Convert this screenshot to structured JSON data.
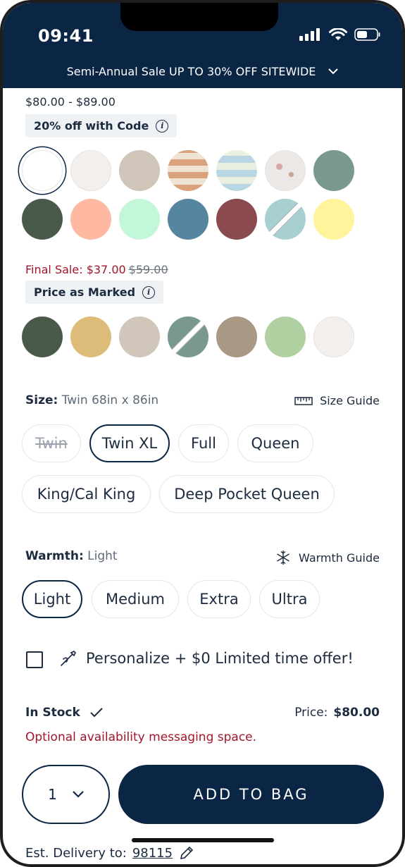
{
  "status_bar": {
    "time": "09:41"
  },
  "promo_banner": {
    "text": "Semi-Annual Sale UP TO 30% OFF SITEWIDE"
  },
  "product": {
    "price_range": "$80.00 - $89.00",
    "code_badge": "20% off with Code",
    "colors_regular": [
      {
        "name": "white",
        "color": "#ffffff"
      },
      {
        "name": "cream",
        "color": "#f3efed"
      },
      {
        "name": "stone",
        "color": "#cfc5b8"
      },
      {
        "name": "floral-stripe",
        "color": "#d9a27a"
      },
      {
        "name": "sky-floral",
        "color": "#b9d6e4"
      },
      {
        "name": "cherry-blossom",
        "color": "#e9e5e3"
      },
      {
        "name": "sage",
        "color": "#79998f"
      },
      {
        "name": "forest",
        "color": "#4a5a4a"
      },
      {
        "name": "peach",
        "color": "#ffb8a1"
      },
      {
        "name": "mint",
        "color": "#c3f7d9"
      },
      {
        "name": "denim",
        "color": "#55859f"
      },
      {
        "name": "burgundy",
        "color": "#8b4a4d"
      },
      {
        "name": "aqua-unavailable",
        "color": "#a8cfd1"
      },
      {
        "name": "lemon",
        "color": "#fff39b"
      }
    ],
    "final_sale": {
      "label": "Final Sale: $37.00",
      "was": "$59.00"
    },
    "price_marked_badge": "Price as Marked",
    "colors_final": [
      {
        "name": "forest",
        "color": "#4a5a4a"
      },
      {
        "name": "honey",
        "color": "#ddbc79"
      },
      {
        "name": "stone",
        "color": "#d0c6b9"
      },
      {
        "name": "sage-unavailable",
        "color": "#79998f"
      },
      {
        "name": "taupe",
        "color": "#a89985"
      },
      {
        "name": "celery",
        "color": "#b0d0a2"
      },
      {
        "name": "cream",
        "color": "#f3efed"
      }
    ],
    "size": {
      "label": "Size:",
      "value": "Twin 68in x 86in",
      "guide": "Size Guide",
      "options": [
        "Twin",
        "Twin XL",
        "Full",
        "Queen",
        "King/Cal King",
        "Deep Pocket Queen"
      ]
    },
    "warmth": {
      "label": "Warmth:",
      "value": "Light",
      "guide": "Warmth Guide",
      "options": [
        "Light",
        "Medium",
        "Extra",
        "Ultra"
      ]
    },
    "personalize": {
      "text": "Personalize + $0  Limited time offer!"
    },
    "stock": {
      "status": "In Stock",
      "price_label": "Price:",
      "price_value": "$80.00",
      "message": "Optional availability messaging space."
    },
    "quantity": "1",
    "add_to_bag": "ADD TO BAG",
    "delivery": {
      "label": "Est. Delivery to:",
      "zip": "98115"
    }
  },
  "colors": {
    "navy": "#0b2545",
    "sale_red": "#a3152b"
  }
}
